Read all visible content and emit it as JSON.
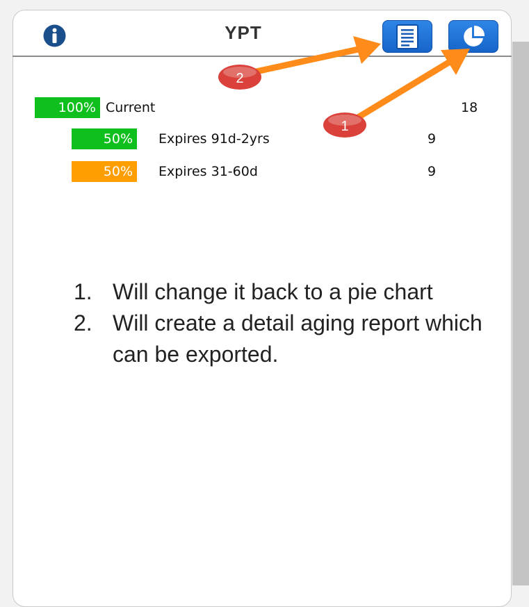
{
  "panel": {
    "title": "YPT"
  },
  "rows": [
    {
      "pct": "100%",
      "label": "Current",
      "count": "18",
      "color": "#0fbf1d"
    },
    {
      "pct": "50%",
      "label": "Expires 91d-2yrs",
      "count": "9",
      "color": "#0fbf1d"
    },
    {
      "pct": "50%",
      "label": "Expires 31-60d",
      "count": "9",
      "color": "#ff9e00"
    }
  ],
  "callouts": [
    {
      "number": "1"
    },
    {
      "number": "2"
    }
  ],
  "notes": [
    {
      "number": "1.",
      "text": "Will change it back to a pie chart"
    },
    {
      "number": "2.",
      "text": "Will create a detail aging report which can be exported."
    }
  ],
  "icons": {
    "info": "info-icon",
    "detail_report": "document-list-icon",
    "chart": "pie-chart-icon"
  },
  "colors": {
    "button_blue": "#1f74d8",
    "arrow_orange": "#ff8c1a",
    "badge_red": "#d9413a"
  }
}
